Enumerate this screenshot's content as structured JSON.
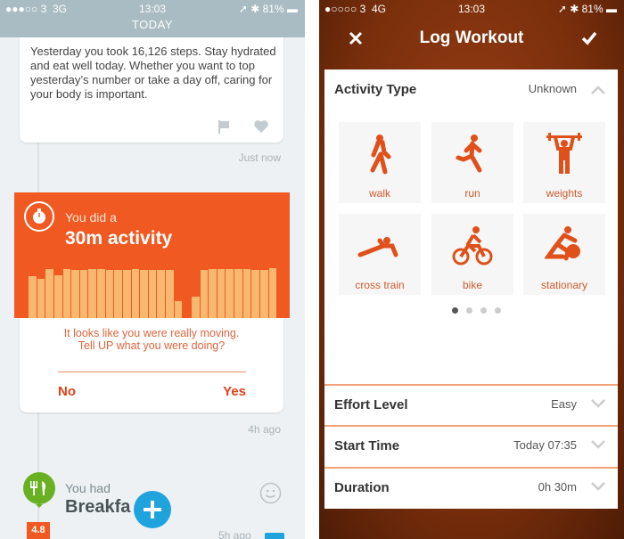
{
  "left_screen": {
    "status": {
      "carrier": "3",
      "network": "3G",
      "time": "13:03",
      "battery": "81%"
    },
    "header": "TODAY",
    "message_card": {
      "text": "Yesterday you took 16,126 steps. Stay hydrated and eat well today. Whether you want to top yesterday’s number or take a day off, caring for your body is important.",
      "icons": [
        "flag-icon",
        "heart-icon"
      ],
      "timestamp": "Just now"
    },
    "activity_card": {
      "pre": "You did a",
      "title": "30m activity",
      "icon": "stopwatch-icon",
      "bar_levels": [
        0.75,
        0.7,
        0.87,
        0.76,
        0.87,
        0.86,
        0.86,
        0.87,
        0.87,
        0.86,
        0.86,
        0.86,
        0.87,
        0.86,
        0.86,
        0.86,
        0.85,
        0.3,
        0,
        0.38,
        0.86,
        0.88,
        0.87,
        0.87,
        0.87,
        0.87,
        0.86,
        0.85,
        0.89
      ],
      "prompt": "It looks like you were really moving. Tell UP what you were doing?",
      "no": "No",
      "yes": "Yes",
      "timestamp": "4h ago"
    },
    "meal": {
      "pre": "You had",
      "title": "Breakfa",
      "score": "4.8",
      "timestamp": "5h ago",
      "icons": [
        "fork-knife-icon",
        "smiley-icon",
        "plus-icon"
      ]
    },
    "colors": {
      "orange": "#f05a22",
      "bar": "#f9b870",
      "green": "#6ab023",
      "blue": "#1fa3dc"
    }
  },
  "right_screen": {
    "status": {
      "carrier": "3",
      "network": "4G",
      "time": "13:03",
      "battery": "81%"
    },
    "title": "Log Workout",
    "activity_type": {
      "label": "Activity Type",
      "value": "Unknown"
    },
    "activities": [
      {
        "label": "walk",
        "icon": "walk-icon"
      },
      {
        "label": "run",
        "icon": "run-icon"
      },
      {
        "label": "weights",
        "icon": "weights-icon"
      },
      {
        "label": "cross train",
        "icon": "cross-train-icon"
      },
      {
        "label": "bike",
        "icon": "bike-icon"
      },
      {
        "label": "stationary",
        "icon": "stationary-bike-icon"
      }
    ],
    "page_dots": {
      "count": 4,
      "active": 1
    },
    "rows": [
      {
        "label": "Effort Level",
        "value": "Easy"
      },
      {
        "label": "Start Time",
        "value": "Today 07:35"
      },
      {
        "label": "Duration",
        "value": "0h 30m"
      }
    ]
  }
}
